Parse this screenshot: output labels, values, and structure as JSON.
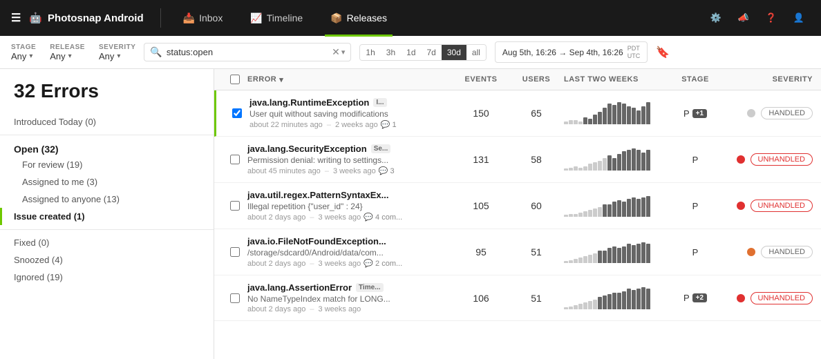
{
  "app": {
    "name": "Photosnap Android",
    "logo_icon": "🤖"
  },
  "nav": {
    "items": [
      {
        "id": "inbox",
        "label": "Inbox",
        "icon": "📥",
        "active": false
      },
      {
        "id": "timeline",
        "label": "Timeline",
        "icon": "📈",
        "active": false
      },
      {
        "id": "releases",
        "label": "Releases",
        "icon": "📦",
        "active": true
      }
    ],
    "icons": [
      {
        "id": "settings",
        "label": "⚙️"
      },
      {
        "id": "announcements",
        "label": "📣"
      },
      {
        "id": "help",
        "label": "❓"
      },
      {
        "id": "account",
        "label": "👤"
      }
    ]
  },
  "filters": {
    "stage": {
      "label": "STAGE",
      "value": "Any"
    },
    "release": {
      "label": "RELEASE",
      "value": "Any"
    },
    "severity": {
      "label": "SEVERITY",
      "value": "Any"
    },
    "search": {
      "value": "status:open",
      "placeholder": "Search..."
    },
    "time_buttons": [
      "1h",
      "3h",
      "1d",
      "7d",
      "30d",
      "all"
    ],
    "active_time": "30d",
    "date_range": "Aug 5th, 16:26 → Sep 4th, 16:26",
    "timezone": "PDT\nUTC"
  },
  "sidebar": {
    "error_count": "32 Errors",
    "items": [
      {
        "id": "introduced-today",
        "label": "Introduced Today (0)",
        "active": false,
        "child": false
      },
      {
        "id": "open",
        "label": "Open (32)",
        "active": false,
        "parent": true
      },
      {
        "id": "for-review",
        "label": "For review (19)",
        "active": false,
        "child": true
      },
      {
        "id": "assigned-to-me",
        "label": "Assigned to me (3)",
        "active": false,
        "child": true
      },
      {
        "id": "assigned-to-anyone",
        "label": "Assigned to anyone (13)",
        "active": false,
        "child": true
      },
      {
        "id": "issue-created",
        "label": "Issue created (1)",
        "active": true,
        "child": true
      },
      {
        "id": "fixed",
        "label": "Fixed (0)",
        "active": false,
        "child": false
      },
      {
        "id": "snoozed",
        "label": "Snoozed (4)",
        "active": false,
        "child": false
      },
      {
        "id": "ignored",
        "label": "Ignored (19)",
        "active": false,
        "child": false
      }
    ]
  },
  "table": {
    "headers": {
      "error": "ERROR",
      "events": "EVENTS",
      "users": "USERS",
      "last_two_weeks": "LAST TWO WEEKS",
      "stage": "STAGE",
      "severity": "SEVERITY"
    },
    "rows": [
      {
        "id": 1,
        "title": "java.lang.RuntimeException",
        "title_suffix": "I...",
        "message": "User quit without saving modifications",
        "time": "about 22 minutes ago",
        "duration": "2 weeks ago",
        "comments": "1",
        "events": 150,
        "users": 65,
        "stage": "P",
        "stage_badge": "+1",
        "severity_type": "handled",
        "dot_color": "gray",
        "selected": true,
        "bars": [
          1,
          2,
          2,
          1,
          3,
          2,
          4,
          5,
          7,
          9,
          8,
          10,
          9,
          8,
          7,
          6,
          8,
          10,
          12,
          10
        ]
      },
      {
        "id": 2,
        "title": "java.lang.SecurityException",
        "title_suffix": "Se...",
        "message": "Permission denial: writing to settings...",
        "time": "about 45 minutes ago",
        "duration": "3 weeks ago",
        "comments": "3",
        "events": 131,
        "users": 58,
        "stage": "P",
        "stage_badge": "",
        "severity_type": "unhandled",
        "dot_color": "red",
        "selected": false,
        "bars": [
          1,
          1,
          2,
          1,
          2,
          3,
          3,
          4,
          5,
          6,
          5,
          7,
          8,
          9,
          10,
          9,
          8,
          9,
          10,
          11
        ]
      },
      {
        "id": 3,
        "title": "java.util.regex.PatternSyntaxEx...",
        "title_suffix": "",
        "message": "Illegal repetition {\"user_id\" : 24}",
        "time": "about 2 days ago",
        "duration": "3 weeks ago",
        "comments": "4 com...",
        "events": 105,
        "users": 60,
        "stage": "P",
        "stage_badge": "",
        "severity_type": "unhandled",
        "dot_color": "red",
        "selected": false,
        "bars": [
          1,
          1,
          1,
          2,
          2,
          3,
          3,
          4,
          5,
          5,
          6,
          7,
          6,
          7,
          8,
          7,
          8,
          9,
          8,
          9
        ]
      },
      {
        "id": 4,
        "title": "java.io.FileNotFoundException...",
        "title_suffix": "",
        "message": "/storage/sdcard0/Android/data/com...",
        "time": "about 2 days ago",
        "duration": "3 weeks ago",
        "comments": "2 com...",
        "events": 95,
        "users": 51,
        "stage": "P",
        "stage_badge": "",
        "severity_type": "handled",
        "dot_color": "orange",
        "selected": false,
        "bars": [
          1,
          1,
          2,
          2,
          3,
          3,
          4,
          5,
          5,
          6,
          7,
          6,
          7,
          8,
          7,
          8,
          9,
          8,
          7,
          8
        ]
      },
      {
        "id": 5,
        "title": "java.lang.AssertionError",
        "title_suffix": "Time...",
        "message": "No NameTypeIndex match for LONG...",
        "time": "about 2 days ago",
        "duration": "3 weeks ago",
        "comments": "",
        "events": 106,
        "users": 51,
        "stage": "P",
        "stage_badge": "+2",
        "severity_type": "unhandled",
        "dot_color": "red",
        "selected": false,
        "bars": [
          1,
          1,
          2,
          2,
          3,
          3,
          4,
          5,
          6,
          6,
          7,
          7,
          8,
          9,
          8,
          9,
          10,
          9,
          10,
          11
        ]
      }
    ]
  }
}
